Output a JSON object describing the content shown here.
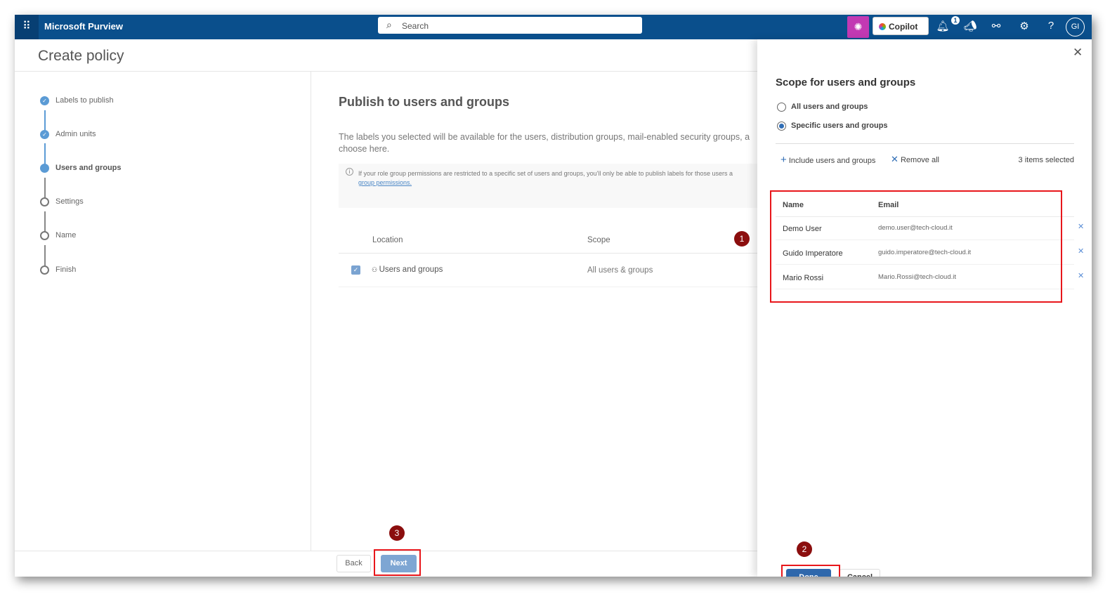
{
  "topbar": {
    "app_title": "Microsoft Purview",
    "search_placeholder": "Search",
    "copilot_label": "Copilot",
    "notification_count": "1",
    "avatar_initials": "GI",
    "accent": "#0a4f8c"
  },
  "page": {
    "title": "Create policy"
  },
  "steps": [
    {
      "label": "Labels to publish",
      "state": "done"
    },
    {
      "label": "Admin units",
      "state": "done"
    },
    {
      "label": "Users and groups",
      "state": "current"
    },
    {
      "label": "Settings",
      "state": "pending"
    },
    {
      "label": "Name",
      "state": "pending"
    },
    {
      "label": "Finish",
      "state": "pending"
    }
  ],
  "main": {
    "heading": "Publish to users and groups",
    "desc_line1": "The labels you selected will be available for the users, distribution groups, mail-enabled security groups, a",
    "desc_line2": "choose here.",
    "info_text": "If your role group permissions are restricted to a specific set of users and groups, you'll only be able to publish labels for those users a",
    "info_link": "group permissions.",
    "columns": [
      "Location",
      "Scope"
    ],
    "rows": [
      {
        "location": "Users and groups",
        "scope": "All users & groups",
        "checked": true
      }
    ],
    "back_label": "Back",
    "next_label": "Next"
  },
  "panel": {
    "title": "Scope for users and groups",
    "options": [
      {
        "label": "All users and groups",
        "selected": false
      },
      {
        "label": "Specific users and groups",
        "selected": true
      }
    ],
    "include_label": "Include users and groups",
    "remove_all_label": "Remove all",
    "selected_count": "3 items selected",
    "columns": [
      "Name",
      "Email"
    ],
    "users": [
      {
        "name": "Demo User",
        "email": "demo.user@tech-cloud.it"
      },
      {
        "name": "Guido Imperatore",
        "email": "guido.imperatore@tech-cloud.it"
      },
      {
        "name": "Mario Rossi",
        "email": "Mario.Rossi@tech-cloud.it"
      }
    ],
    "done_label": "Done",
    "cancel_label": "Cancel"
  },
  "annotations": [
    "1",
    "2",
    "3"
  ]
}
